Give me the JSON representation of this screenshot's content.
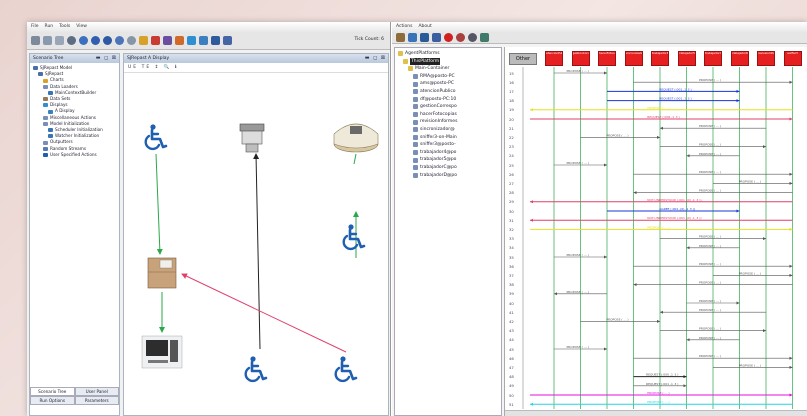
{
  "left_window": {
    "menu": [
      "File",
      "Run",
      "Tools",
      "View"
    ],
    "tick_count": "Tick Count: 6",
    "toolbar_icons": [
      "save-icon",
      "open-icon",
      "settings-icon",
      "initialize-icon",
      "play-icon",
      "step-icon",
      "stop-icon",
      "pause-icon",
      "reset-icon",
      "chart-icon",
      "grid-icon",
      "layer-icon",
      "home-icon",
      "globe-icon",
      "picture-icon",
      "film-icon"
    ],
    "scenario_tree": {
      "title": "Scenario Tree",
      "items": [
        {
          "label": "SJRepast Model",
          "depth": 0
        },
        {
          "label": "SJRepast",
          "depth": 1
        },
        {
          "label": "Charts",
          "depth": 2
        },
        {
          "label": "Data Loaders",
          "depth": 2
        },
        {
          "label": "MainContextBuilder",
          "depth": 3
        },
        {
          "label": "Data Sets",
          "depth": 2
        },
        {
          "label": "Displays",
          "depth": 2
        },
        {
          "label": "A Display",
          "depth": 3
        },
        {
          "label": "Miscellaneous Actions",
          "depth": 2
        },
        {
          "label": "Model Initialization",
          "depth": 2
        },
        {
          "label": "Scheduler Initialization",
          "depth": 3
        },
        {
          "label": "Watcher Initialization",
          "depth": 3
        },
        {
          "label": "Outputters",
          "depth": 2
        },
        {
          "label": "Random Streams",
          "depth": 2
        },
        {
          "label": "User Specified Actions",
          "depth": 2
        }
      ]
    },
    "bottom_tabs": {
      "row1": [
        "Scenario Tree",
        "User Panel"
      ],
      "row2": [
        "Run Options",
        "Parameters"
      ]
    },
    "display": {
      "title": "SJRepast A Display",
      "toolbar": "UE  TE  ↕  🔍  ℹ"
    }
  },
  "right_window": {
    "menu": [
      "Actions",
      "About"
    ],
    "agent_tree": {
      "root": "AgentPlatforms",
      "platform": "ThisPlatform",
      "container": "Main-Container",
      "agents": [
        "RMA@posto-PC",
        "ams@posto-PC",
        "atencionPublico",
        "df@posto-PC:10",
        "gestionCorrespo",
        "hacerFotocopias",
        "revisionInformes",
        "sincronizador@",
        "sniffer3-on-Main",
        "sniffer3@posto-",
        "trabajador4@po",
        "trabajador5@po",
        "trabajadorC@po",
        "trabajadorD@po"
      ]
    },
    "sequence": {
      "other_label": "Other",
      "agent_boxes": [
        "atencionPublico",
        "gestionCorrespondencia",
        "hacerFotocopias",
        "sincronizador",
        "trabajador4",
        "trabajador5",
        "trabajadorC",
        "trabajadorD",
        "revisionInformes",
        "sniffer3"
      ],
      "messages": [
        {
          "row": 15,
          "label": "PROPOSE ( ... )"
        },
        {
          "row": 16,
          "label": "PROPOSE ( ... )"
        },
        {
          "row": 17,
          "label": "REQUEST (:001 ,1_3 )"
        },
        {
          "row": 18,
          "label": "REQUEST (:001 ,1_3 )"
        },
        {
          "row": 19,
          "label": "PROPOSE ( ... )"
        },
        {
          "row": 20,
          "label": "REQUEST (:006 ,1_3 )"
        },
        {
          "row": 21,
          "label": "PROPOSE ( ... )"
        },
        {
          "row": 22,
          "label": "PROPOSE ( ... )"
        },
        {
          "row": 23,
          "label": "PROPOSE ( ... )"
        },
        {
          "row": 24,
          "label": "PROPOSE ( ... )"
        },
        {
          "row": 25,
          "label": "PROPOSE ( ... )"
        },
        {
          "row": 26,
          "label": "PROPOSE ( ... )"
        },
        {
          "row": 27,
          "label": "PROPOSE ( ... )"
        },
        {
          "row": 28,
          "label": "PROPOSE ( ... )"
        },
        {
          "row": 29,
          "label": "NOT-UNDERSTOOD (:001 ,(0) ,1_3 ))"
        },
        {
          "row": 30,
          "label": "AGREE (:001 ,(0) ,1_3 ))"
        },
        {
          "row": 31,
          "label": "NOT-UNDERSTOOD (:001 ,(0) ,1_3 ))"
        },
        {
          "row": 32,
          "label": "PROPOSE ( ... )"
        },
        {
          "row": 33,
          "label": "PROPOSE ( ... )"
        },
        {
          "row": 34,
          "label": "PROPOSE ( ... )"
        },
        {
          "row": 35,
          "label": "PROPOSE ( ... )"
        },
        {
          "row": 36,
          "label": "PROPOSE ( ... )"
        },
        {
          "row": 37,
          "label": "PROPOSE ( ... )"
        },
        {
          "row": 38,
          "label": "PROPOSE ( ... )"
        },
        {
          "row": 39,
          "label": "PROPOSE ( ... )"
        },
        {
          "row": 40,
          "label": "PROPOSE ( ... )"
        },
        {
          "row": 41,
          "label": "PROPOSE ( ... )"
        },
        {
          "row": 42,
          "label": "PROPOSE ( ... )"
        },
        {
          "row": 43,
          "label": "PROPOSE ( ... )"
        },
        {
          "row": 44,
          "label": "PROPOSE ( ... )"
        },
        {
          "row": 45,
          "label": "PROPOSE ( ... )"
        },
        {
          "row": 46,
          "label": "PROPOSE ( ... )"
        },
        {
          "row": 47,
          "label": "PROPOSE ( ... )"
        },
        {
          "row": 48,
          "label": "REQUEST (:000 ,1_3 )"
        },
        {
          "row": 49,
          "label": "REQUEST (:001 ,1_3 )"
        },
        {
          "row": 50,
          "label": "PROPOSE ( ... )"
        },
        {
          "row": 51,
          "label": "PROPOSE ( ... )"
        }
      ]
    }
  },
  "colors": {
    "accent_red": "#e62020",
    "lifeline_green": "#2aa84a",
    "arrow_pink": "#e0406a",
    "arrow_blue": "#1a35d8",
    "arrow_magenta": "#e010e0",
    "arrow_yellow": "#e6e020",
    "arrow_cyan": "#22d6e6",
    "wheelchair_blue": "#1f5fb0"
  }
}
